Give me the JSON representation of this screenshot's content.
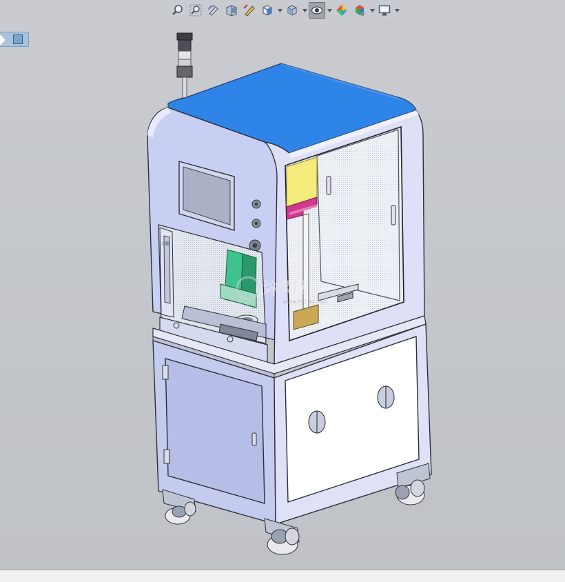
{
  "app": {
    "name": "SolidWorks 3D view"
  },
  "colors": {
    "viewport_bg": "#c4c7cc",
    "cabinet_top": "#2f84e8",
    "cabinet_body": "#c9cef3",
    "glass": "#dfe7f2",
    "yellow_part": "#f3ec7a",
    "magenta_part": "#d0398f",
    "green_part": "#3fc28d"
  },
  "toolbar": {
    "items": [
      {
        "icon": "zoom-to-fit-icon"
      },
      {
        "icon": "zoom-to-area-icon"
      },
      {
        "icon": "previous-view-icon"
      },
      {
        "icon": "section-view-icon"
      },
      {
        "icon": "dynamic-annotation-icon"
      },
      {
        "icon": "view-orientation-icon",
        "dropdown": true
      },
      {
        "icon": "display-style-icon",
        "dropdown": true
      },
      {
        "icon": "hide-show-items-icon",
        "dropdown": true,
        "active": true
      },
      {
        "icon": "edit-appearance-icon"
      },
      {
        "icon": "apply-scene-icon",
        "dropdown": true
      },
      {
        "icon": "view-settings-icon",
        "dropdown": true
      }
    ]
  },
  "model": {
    "watermark_text": "沐风网",
    "watermark_url": "www.mfcad.com"
  }
}
